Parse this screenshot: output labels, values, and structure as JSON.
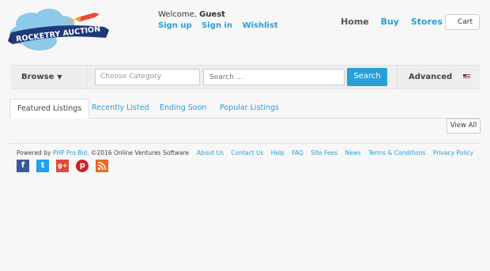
{
  "brand": {
    "logo_text": "ROCKETRY AUCTION"
  },
  "header": {
    "welcome_prefix": "Welcome,",
    "welcome_user": "Guest",
    "user_links": [
      "Sign up",
      "Sign in",
      "Wishlist"
    ],
    "nav": [
      "Home",
      "Buy",
      "Stores"
    ],
    "cart_label": "Cart"
  },
  "searchbar": {
    "browse_label": "Browse",
    "category_placeholder": "Choose Category",
    "search_placeholder": "Search ...",
    "search_button": "Search",
    "advanced_label": "Advanced",
    "flag": "us-flag-icon"
  },
  "tabs": [
    "Featured Listings",
    "Recently Listed",
    "Ending Soon",
    "Popular Listings"
  ],
  "view_all_label": "View All",
  "footer": {
    "powered_prefix": "Powered by",
    "powered_link": "PHP Pro Bid",
    "copyright": ". ©2016 Online Ventures Software",
    "links": [
      "About Us",
      "Contact Us",
      "Help",
      "FAQ",
      "Site Fees",
      "News",
      "Terms & Conditions",
      "Privacy Policy"
    ],
    "social": [
      "facebook-icon",
      "twitter-icon",
      "google-plus-icon",
      "pinterest-icon",
      "rss-icon"
    ]
  },
  "colors": {
    "accent": "#2a9fd6",
    "background": "#f7f7f7"
  }
}
